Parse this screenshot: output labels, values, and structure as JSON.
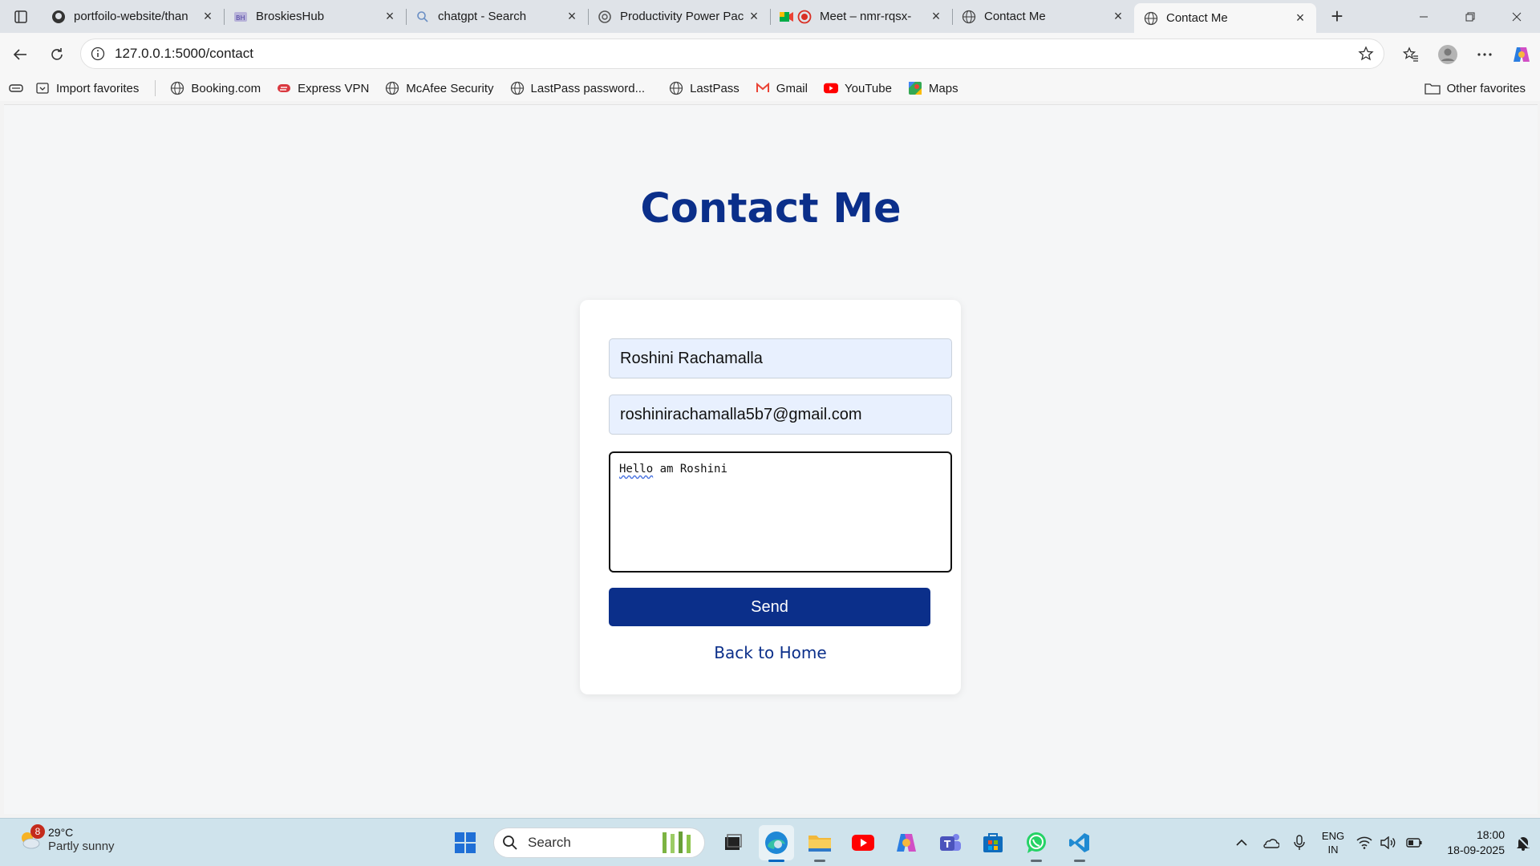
{
  "browser": {
    "tabs": [
      {
        "title": "portfoilo-website/than",
        "icon": "github-icon"
      },
      {
        "title": "BroskiesHub",
        "icon": "broskieshub-icon"
      },
      {
        "title": "chatgpt - Search",
        "icon": "search-icon"
      },
      {
        "title": "Productivity Power Pac",
        "icon": "openai-icon"
      },
      {
        "title": "Meet – nmr-rqsx-",
        "icon": "meet-icon"
      },
      {
        "title": "Contact Me",
        "icon": "globe-icon"
      },
      {
        "title": "Contact Me",
        "icon": "globe-icon",
        "active": true
      }
    ],
    "url": "127.0.0.1:5000/contact",
    "favorites": [
      {
        "label": "Import favorites",
        "icon": "import-icon"
      },
      {
        "label": "Booking.com",
        "icon": "globe-icon"
      },
      {
        "label": "Express VPN",
        "icon": "expressvpn-icon"
      },
      {
        "label": "McAfee Security",
        "icon": "globe-icon"
      },
      {
        "label": "LastPass password...",
        "icon": "globe-icon"
      },
      {
        "label": "LastPass",
        "icon": "globe-icon"
      },
      {
        "label": "Gmail",
        "icon": "gmail-icon"
      },
      {
        "label": "YouTube",
        "icon": "youtube-icon"
      },
      {
        "label": "Maps",
        "icon": "maps-icon"
      }
    ],
    "other_favorites": "Other favorites"
  },
  "page": {
    "heading": "Contact Me",
    "form": {
      "name_value": "Roshini Rachamalla",
      "email_value": "roshinirachamalla5b7@gmail.com",
      "message_first_word": "Hello",
      "message_rest": " am Roshini",
      "send_label": "Send",
      "back_link": "Back to Home"
    }
  },
  "taskbar": {
    "weather_badge": "8",
    "weather_temp": "29°C",
    "weather_cond": "Partly sunny",
    "search_label": "Search",
    "lang_line1": "ENG",
    "lang_line2": "IN",
    "time": "18:00",
    "date": "18-09-2025"
  },
  "colors": {
    "accent": "#0b2f8a",
    "autofill": "#e8f0fe",
    "taskbar": "#cfe3ec"
  }
}
